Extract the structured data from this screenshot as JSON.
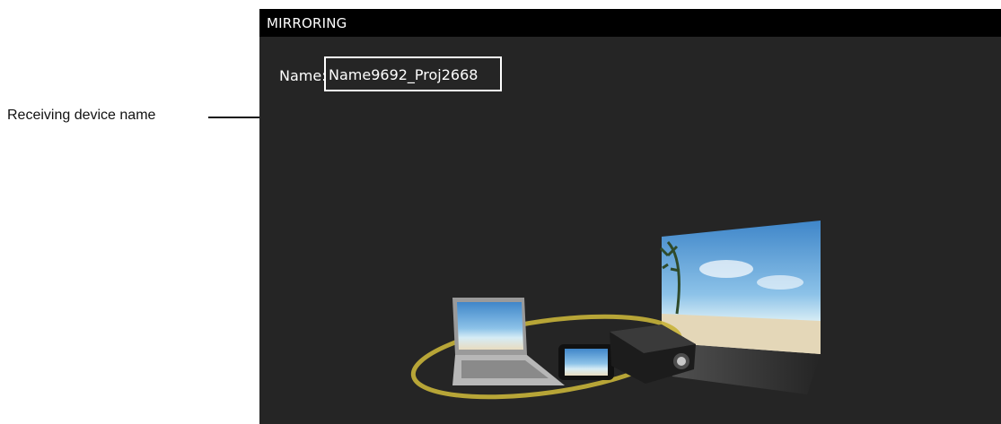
{
  "callout": {
    "label": "Receiving device name"
  },
  "window": {
    "title": "MIRRORING"
  },
  "device": {
    "name_label": "Name:",
    "name_value": "Name9692_Proj2668"
  },
  "illustration": {
    "icons": [
      "laptop-icon",
      "smartphone-icon",
      "projector-icon",
      "projection-screen-icon"
    ]
  },
  "colors": {
    "background": "#252525",
    "title_bar": "#000000",
    "text": "#ffffff",
    "ring": "#c8b43a"
  }
}
